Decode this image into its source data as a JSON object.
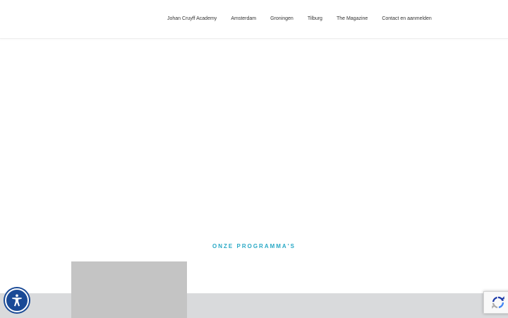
{
  "nav": {
    "items": [
      {
        "label": "Johan Cruyff Academy"
      },
      {
        "label": "Amsterdam"
      },
      {
        "label": "Groningen"
      },
      {
        "label": "Tilburg"
      },
      {
        "label": "The Magazine"
      },
      {
        "label": "Contact en aanmelden"
      }
    ]
  },
  "programs": {
    "title": "ONZE PROGRAMMA'S"
  },
  "icons": {
    "accessibility": "accessibility-icon",
    "recaptcha": "recaptcha-icon"
  },
  "colors": {
    "accent": "#29a9c6",
    "a11y": "#1a4a96",
    "band": "#d9dadc",
    "placeholder": "#c4c4c4"
  }
}
